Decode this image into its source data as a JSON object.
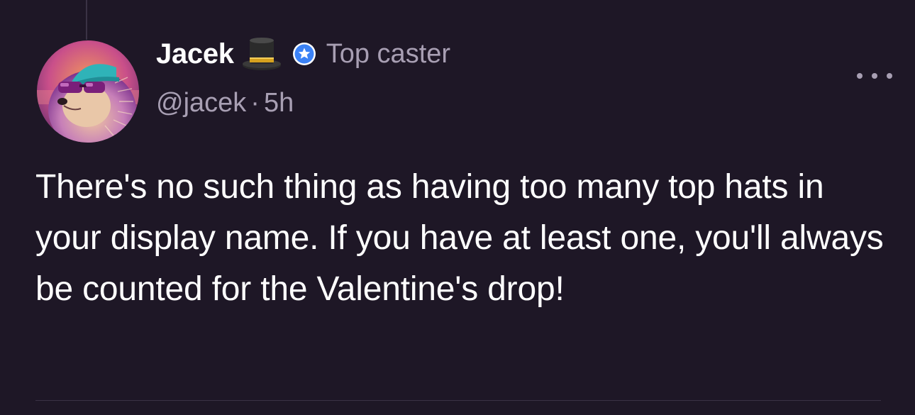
{
  "post": {
    "author": {
      "display_name": "Jacek",
      "name_emoji": "top-hat-icon",
      "badge_icon": "star-badge-icon",
      "badge_label": "Top caster",
      "handle": "@jacek",
      "separator": "·",
      "timestamp": "5h"
    },
    "more_menu_icon": "ellipsis-icon",
    "text": "There's no such thing as having too many top hats in your display name. If you have at least one, you'll always be counted for the Valentine's drop!"
  },
  "colors": {
    "background": "#1e1726",
    "muted_text": "#a89fb3",
    "badge_blue": "#3b82f6",
    "divider": "#3a3245"
  }
}
